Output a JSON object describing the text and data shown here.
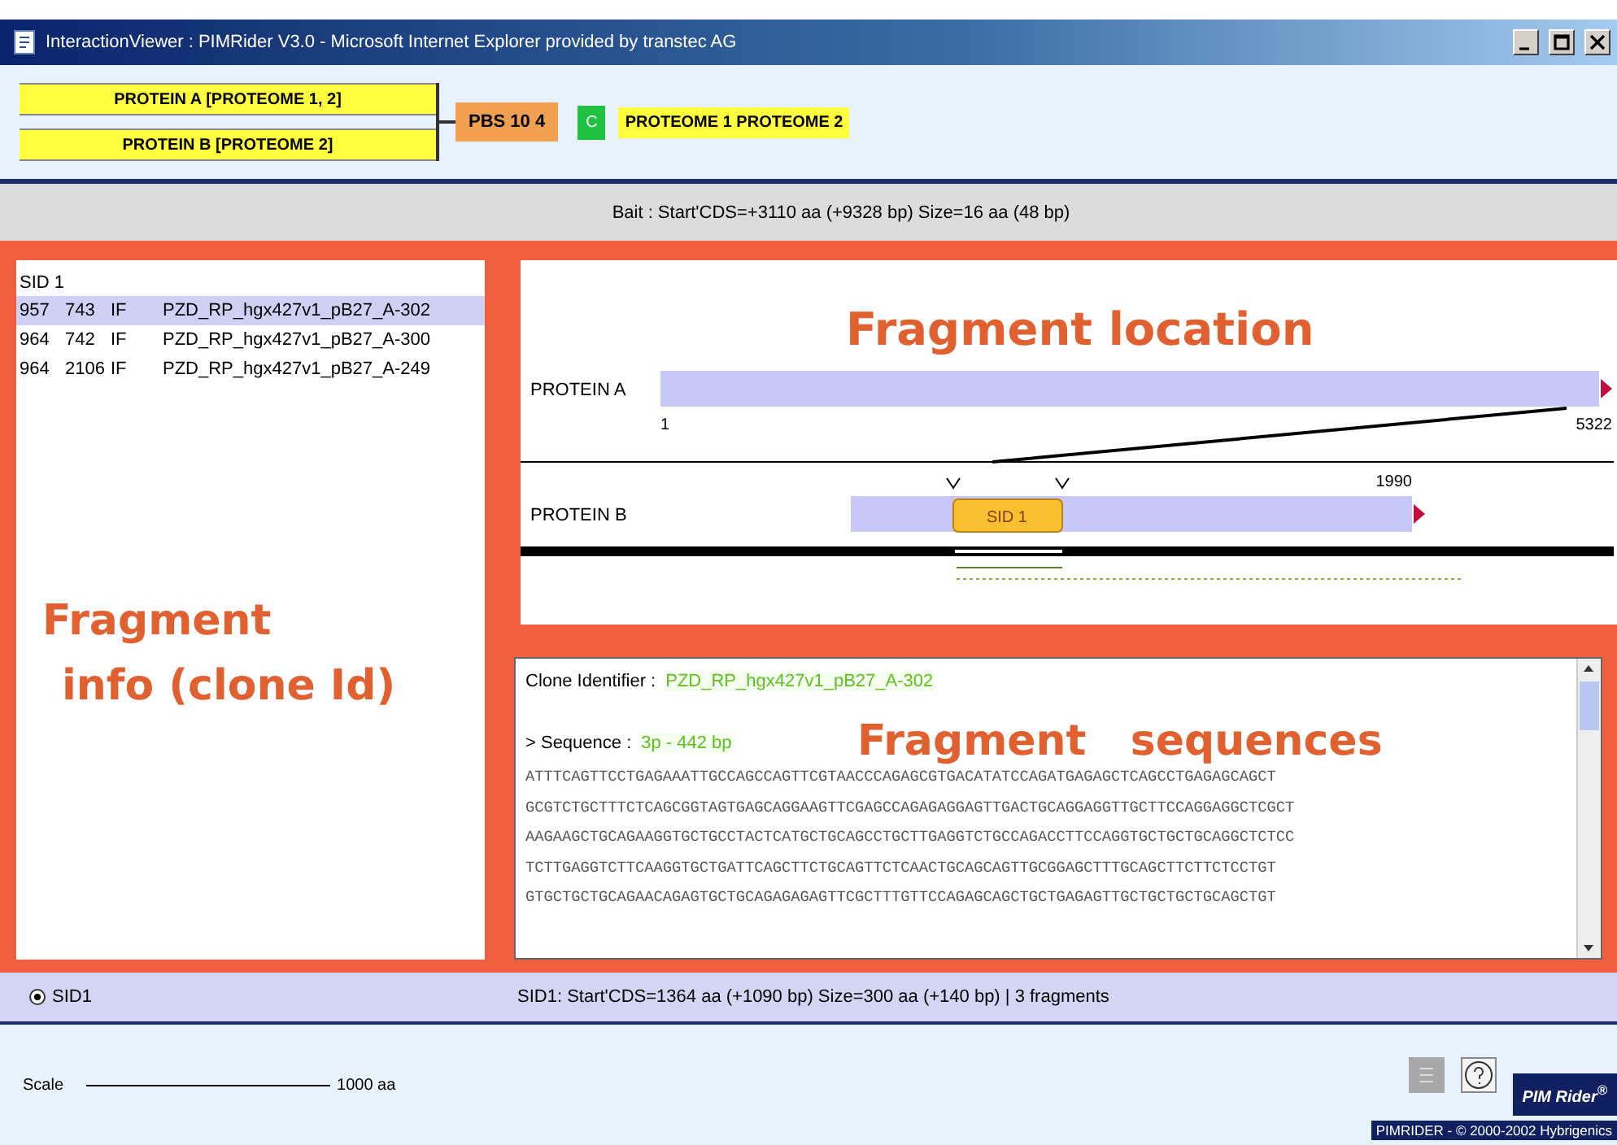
{
  "window": {
    "title": "InteractionViewer : PIMRider V3.0 - Microsoft Internet Explorer provided by transtec AG"
  },
  "interaction": {
    "proteins": [
      "PROTEIN A [PROTEOME 1, 2]",
      "PROTEIN B [PROTEOME 2]"
    ],
    "score": "PBS 10 4",
    "category": "C",
    "proteomes": "PROTEOME 1  PROTEOME 2"
  },
  "bait_info": "Bait : Start'CDS=+3110 aa (+9328 bp)  Size=16 aa (48 bp)",
  "fragments": {
    "header": "SID 1",
    "annotation": [
      "Fragment",
      "info (clone Id)"
    ],
    "rows": [
      {
        "start": "957",
        "end": "743",
        "type": "IF",
        "clone": "PZD_RP_hgx427v1_pB27_A-302",
        "selected": true
      },
      {
        "start": "964",
        "end": "742",
        "type": "IF",
        "clone": "PZD_RP_hgx427v1_pB27_A-300",
        "selected": false
      },
      {
        "start": "964",
        "end": "2106",
        "type": "IF",
        "clone": "PZD_RP_hgx427v1_pB27_A-249",
        "selected": false
      }
    ]
  },
  "location": {
    "annotation": "Fragment   location",
    "tracks": [
      {
        "label": "PROTEIN A",
        "start": "1",
        "end": "5322"
      },
      {
        "label": "PROTEIN B",
        "end": "1990",
        "fragment": "SID 1"
      }
    ]
  },
  "sequences": {
    "annotation": "Fragment   sequences",
    "clone_label": "Clone Identifier :",
    "clone": "PZD_RP_hgx427v1_pB27_A-302",
    "sequence_label": "> Sequence :",
    "sequence_info": "3p - 442 bp",
    "lines": [
      "ATTTCAGTTCCTGAGAAATTGCCAGCCAGTTCGTAACCCAGAGCGTGACATATCCAGATGAGAGCTCAGCCTGAGAGCAGCT",
      "GCGTCTGCTTTCTCAGCGGTAGTGAGCAGGAAGTTCGAGCCAGAGAGGAGTTGACTGCAGGAGGTTGCTTCCAGGAGGCTCGCT",
      "AAGAAGCTGCAGAAGGTGCTGCCTACTCATGCTGCAGCCTGCTTGAGGTCTGCCAGACCTTCCAGGTGCTGCTGCAGGCTCTCC",
      "TCTTGAGGTCTTCAAGGTGCTGATTCAGCTTCTGCAGTTCTCAACTGCAGCAGTTGCGGAGCTTTGCAGCTTCTTCTCCTGT",
      "GTGCTGCTGCAGAACAGAGTGCTGCAGAGAGAGTTCGCTTTGTTCCAGAGCAGCTGCTGAGAGTTGCTGCTGCTGCAGCTGT"
    ]
  },
  "selection": {
    "radio": {
      "label": "SID1",
      "selected": true
    },
    "info": "SID1: Start'CDS=1364 aa (+1090 bp)  Size=300 aa (+140 bp) | 3 fragments"
  },
  "footer": {
    "scale_label": "Scale",
    "scale_value": "1000 aa",
    "logo": "PIM Rider$^{®}$",
    "copyright": "PIMRIDER - © 2000-2002 Hybrigenics"
  }
}
